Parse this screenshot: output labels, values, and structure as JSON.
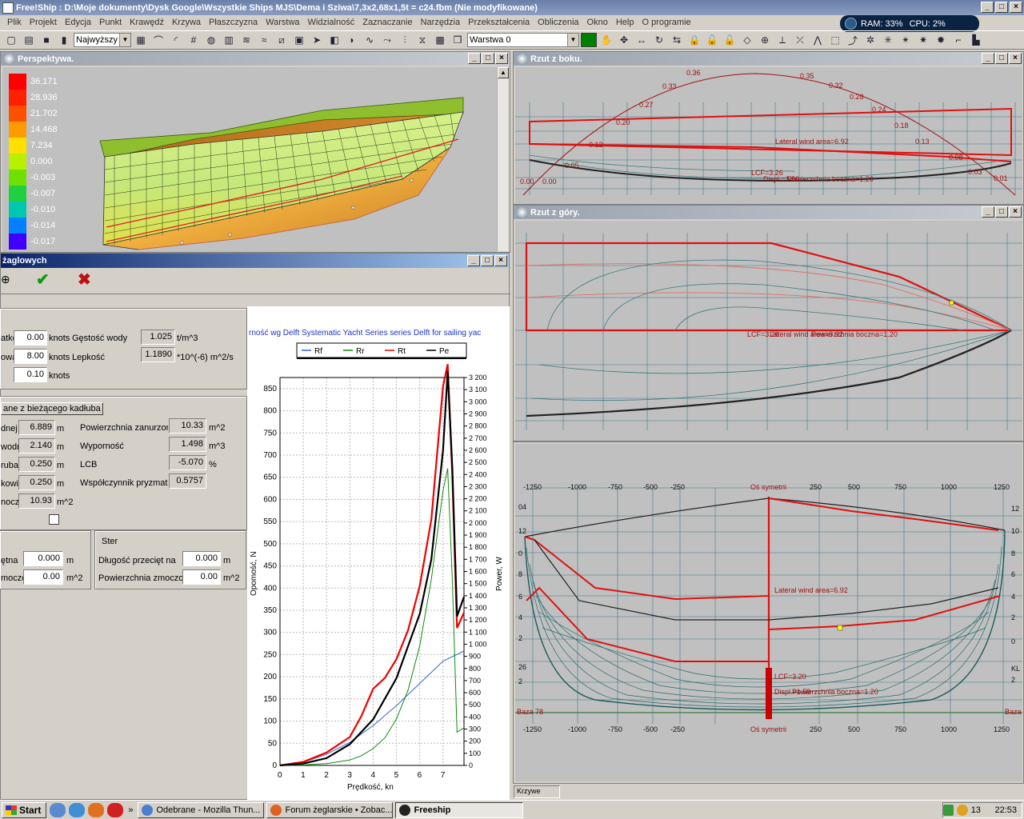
{
  "window": {
    "title": "Free!Ship  : D:\\Moje dokumenty\\Dysk Google\\Wszystkie Ships MJS\\Dema i Sziwa\\7,3x2,68x1,5t = c24.fbm (Nie modyfikowane)"
  },
  "menu": [
    "Plik",
    "Projekt",
    "Edycja",
    "Punkt",
    "Krawędź",
    "Krzywa",
    "Płaszczyzna",
    "Warstwa",
    "Widzialność",
    "Zaznaczanie",
    "Narzędzia",
    "Przekształcenia",
    "Obliczenia",
    "Okno",
    "Help",
    "O programie"
  ],
  "system_monitor": {
    "ram": "RAM: 33%",
    "cpu": "CPU: 2%"
  },
  "toolbar": {
    "precision_select": "Najwyższy",
    "layer_select": "Warstwa 0",
    "layer_color": "#008000"
  },
  "perspective": {
    "title": "Perspektywa.",
    "legend": [
      {
        "value": "36.171",
        "color": "#ff0000"
      },
      {
        "value": "28.936",
        "color": "#ff2000"
      },
      {
        "value": "21.702",
        "color": "#ff5000"
      },
      {
        "value": "14.468",
        "color": "#ff9a00"
      },
      {
        "value": "7.234",
        "color": "#ffe000"
      },
      {
        "value": "0.000",
        "color": "#b8f000"
      },
      {
        "value": "-0.003",
        "color": "#70e000"
      },
      {
        "value": "-0.007",
        "color": "#20d040"
      },
      {
        "value": "-0.010",
        "color": "#00c8b0"
      },
      {
        "value": "-0.014",
        "color": "#0080ff"
      },
      {
        "value": "-0.017",
        "color": "#4000ff"
      }
    ]
  },
  "side_view": {
    "title": "Rzut z boku.",
    "annotations": {
      "lateral": "Lateral wind area=6.92",
      "lcf": "LCF=3.26",
      "displ": "Displ.=1.50",
      "wet": "Powierzchnia boczna=1.20"
    },
    "curve_labels": [
      "0.00",
      "0.00",
      "0.05",
      "0.12",
      "0.20",
      "0.27",
      "0.33",
      "0.36",
      "0.35",
      "0.32",
      "0.28",
      "0.24",
      "0.18",
      "0.13",
      "0.08",
      "0.03",
      "0.01"
    ]
  },
  "plan_view": {
    "title": "Rzut z góry.",
    "annotations": {
      "lcf": "LCF=3.26",
      "lateral": "Lateral wind area=6.92",
      "wet": "Powierzchnia boczna=1.20"
    }
  },
  "body_view": {
    "x_ticks": [
      "-1250",
      "-1000",
      "-750",
      "-500",
      "-250",
      "250",
      "500",
      "750",
      "1000",
      "1250"
    ],
    "symmetry": "Oś symetrii",
    "baseline_left": "Baza 78",
    "baseline_right": "Baza",
    "kl": "KL",
    "annotations": {
      "lateral": "Lateral wind area=6.92",
      "lcf": "LCF=3.20",
      "displ": "Displ.=1.50",
      "wet": "Powierzchnia boczna=1.20"
    },
    "right_ticks": [
      "12",
      "10",
      "8",
      "6",
      "4",
      "2",
      "0",
      "2"
    ],
    "left_ticks": [
      "04",
      "12",
      "0",
      "8",
      "6",
      "4",
      "2",
      "26",
      "2"
    ]
  },
  "dialog": {
    "title": "żaglowych",
    "speed_section": {
      "start_label": "atko",
      "start_value": "0.00",
      "start_unit": "knots",
      "end_label": "owa",
      "end_value": "8.00",
      "end_unit": "knots",
      "step_value": "0.10",
      "step_unit": "knots",
      "density_label": "Gęstość wody",
      "density_value": "1.025",
      "density_unit": "t/m^3",
      "viscosity_label": "Lepkość",
      "viscosity_value": "1.1890",
      "viscosity_unit": "*10^(-6) m^2/s"
    },
    "hull_section": {
      "button": "ane z bieżącego kadłuba",
      "rows": [
        {
          "label": "dnej",
          "value": "6.889",
          "unit": "m"
        },
        {
          "label": "wodn",
          "value": "2.140",
          "unit": "m"
        },
        {
          "label": "ruba",
          "value": "0.250",
          "unit": "m"
        },
        {
          "label": "kowi",
          "value": "0.250",
          "unit": "m"
        },
        {
          "label": "nocz",
          "value": "10.93",
          "unit": "m^2"
        }
      ],
      "right_rows": [
        {
          "label": "Powierzchnia zanurzon",
          "value": "10.33",
          "unit": "m^2"
        },
        {
          "label": "Wyporność",
          "value": "1.498",
          "unit": "m^3"
        },
        {
          "label": "LCB",
          "value": "-5.070",
          "unit": "%"
        },
        {
          "label": "Współczynnik pryzmat",
          "value": "0.5757",
          "unit": ""
        }
      ]
    },
    "keel_section": {
      "row1_label": "ętna",
      "row1_value": "0.000",
      "row1_unit": "m",
      "row2_label": "moczor",
      "row2_value": "0.00",
      "row2_unit": "m^2"
    },
    "rudder_section": {
      "title": "Ster",
      "row1_label": "Długość przecięt na",
      "row1_value": "0.000",
      "row1_unit": "m",
      "row2_label": "Powierzchnia zmoczon",
      "row2_value": "0.00",
      "row2_unit": "m^2"
    }
  },
  "chart_data": {
    "type": "line",
    "title": "rność wg Delft Systematic Yacht Series series Delft for sailing yac",
    "xlabel": "Prędkość, kn",
    "ylabel": "Opomość, N",
    "y2label": "Power, W",
    "xlim": [
      0,
      7.9
    ],
    "ylim": [
      0,
      875
    ],
    "y2lim": [
      0,
      3200
    ],
    "x_ticks": [
      0,
      1,
      2,
      3,
      4,
      5,
      6,
      7
    ],
    "y_ticks": [
      0,
      50,
      100,
      150,
      200,
      250,
      300,
      350,
      400,
      450,
      500,
      550,
      600,
      650,
      700,
      750,
      800,
      850
    ],
    "y2_ticks": [
      "0",
      "100",
      "200",
      "300",
      "400",
      "500",
      "600",
      "700",
      "800",
      "900",
      "1 000",
      "1 100",
      "1 200",
      "1 300",
      "1 400",
      "1 500",
      "1 600",
      "1 700",
      "1 800",
      "1 900",
      "2 000",
      "2 100",
      "2 200",
      "2 300",
      "2 400",
      "2 500",
      "2 600",
      "2 700",
      "2 800",
      "2 900",
      "3 000",
      "3 100",
      "3 200"
    ],
    "legend": "top",
    "series": [
      {
        "name": "Rf",
        "color": "#3366cc",
        "x": [
          0,
          1,
          2,
          3,
          4,
          5,
          6,
          7,
          7.9
        ],
        "y": [
          0,
          7,
          25,
          52,
          90,
          135,
          185,
          235,
          258
        ]
      },
      {
        "name": "Rr",
        "color": "#118811",
        "x": [
          0,
          1,
          2,
          3,
          3.5,
          4,
          4.5,
          5,
          5.5,
          6,
          6.5,
          7,
          7.2,
          7.4,
          7.6,
          7.9
        ],
        "y": [
          0,
          1,
          4,
          12,
          22,
          38,
          62,
          105,
          170,
          270,
          420,
          620,
          670,
          420,
          75,
          85
        ]
      },
      {
        "name": "Rt",
        "color": "#ee0000",
        "x": [
          0,
          1,
          2,
          3,
          3.5,
          4,
          4.5,
          5,
          5.5,
          6,
          6.5,
          7,
          7.2,
          7.4,
          7.6,
          7.9
        ],
        "y": [
          0,
          8,
          29,
          64,
          112,
          173,
          197,
          240,
          305,
          405,
          555,
          855,
          905,
          655,
          310,
          345
        ]
      },
      {
        "name": "Pe",
        "color": "#000000",
        "axis": "y2",
        "x": [
          0,
          1,
          2,
          3,
          4,
          5,
          6,
          6.5,
          7,
          7.2,
          7.4,
          7.6,
          7.9
        ],
        "y": [
          0,
          15,
          60,
          175,
          380,
          720,
          1250,
          1700,
          2600,
          3250,
          2450,
          1230,
          1390
        ]
      }
    ]
  },
  "statusbar": {
    "panel1": "Krzywe"
  },
  "taskbar": {
    "start": "Start",
    "tasks": [
      {
        "label": "Odebrane - Mozilla Thun...",
        "color": "#4a7fd0"
      },
      {
        "label": "Forum żeglarskie • Zobac...",
        "color": "#e06020"
      },
      {
        "label": "Freeship",
        "color": "#222222"
      }
    ],
    "tray_count": "13",
    "clock": "22:53"
  }
}
